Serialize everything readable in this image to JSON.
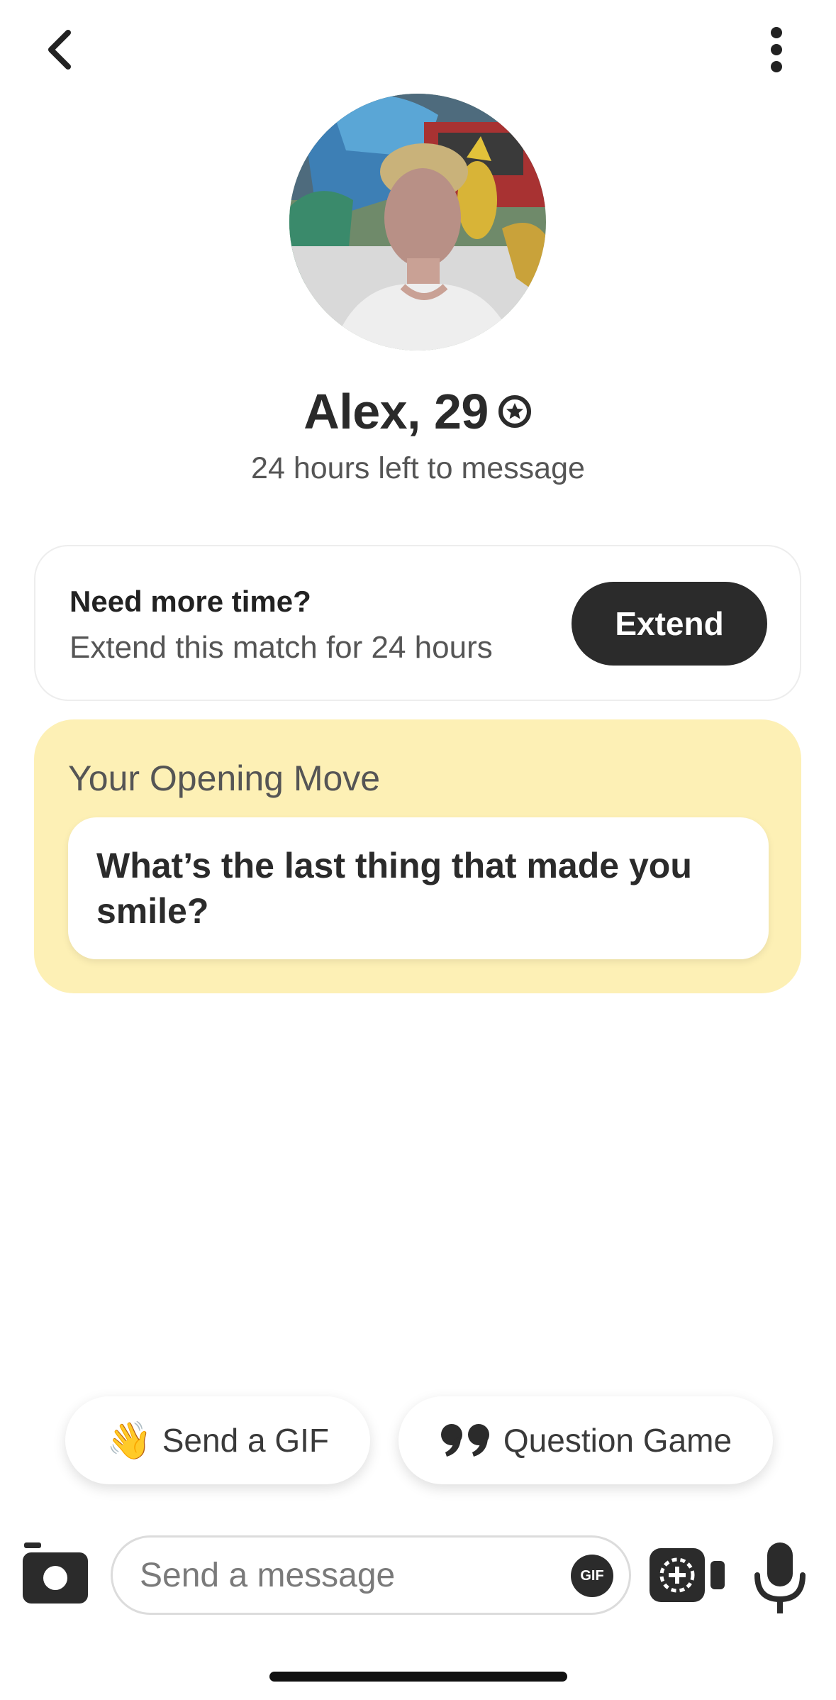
{
  "header": {
    "back_icon": "chevron-left-icon",
    "more_icon": "more-vertical-icon"
  },
  "profile": {
    "name": "Alex, 29",
    "verified_icon": "verified-badge-icon",
    "time_left": "24 hours left to message"
  },
  "extend_card": {
    "title": "Need more time?",
    "subtitle": "Extend this match for 24 hours",
    "button_label": "Extend"
  },
  "opening_move": {
    "label": "Your Opening Move",
    "question": "What’s the last thing that made you smile?",
    "background_color": "#fdf0b5"
  },
  "suggestions": {
    "gif_emoji": "👋",
    "gif_label": "Send a GIF",
    "question_label": "Question Game"
  },
  "composer": {
    "placeholder": "Send a message",
    "gif_badge": "GIF",
    "camera_icon": "camera-icon",
    "video_icon": "video-call-icon",
    "mic_icon": "microphone-icon"
  },
  "colors": {
    "dark": "#2b2b2b",
    "accent_yellow": "#fdf0b5"
  }
}
